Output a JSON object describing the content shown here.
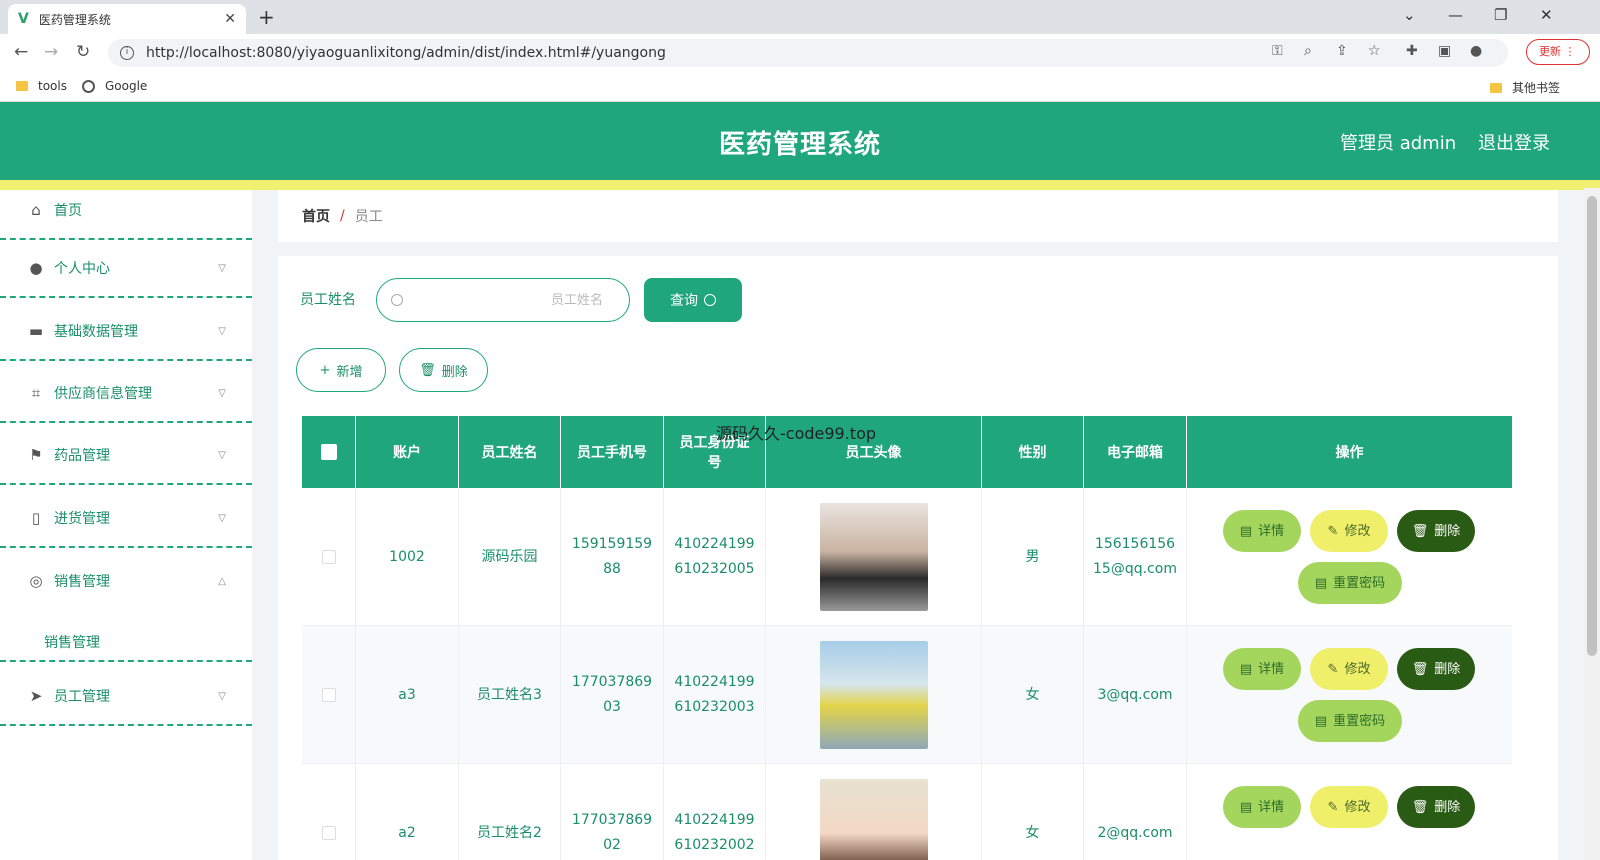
{
  "browser": {
    "tab_title": "医药管理系统",
    "url": "http://localhost:8080/yiyaoguanlixitong/admin/dist/index.html#/yuangong",
    "update_label": "更新",
    "bookmarks": [
      "tools",
      "Google"
    ],
    "other_bookmarks": "其他书签"
  },
  "header": {
    "title": "医药管理系统",
    "user": "管理员 admin",
    "logout": "退出登录"
  },
  "sidebar": {
    "items": [
      {
        "label": "首页",
        "icon": "home-icon"
      },
      {
        "label": "个人中心",
        "icon": "user-icon"
      },
      {
        "label": "基础数据管理",
        "icon": "monitor-icon"
      },
      {
        "label": "供应商信息管理",
        "icon": "crop-icon"
      },
      {
        "label": "药品管理",
        "icon": "flag-icon"
      },
      {
        "label": "进货管理",
        "icon": "phone-icon"
      },
      {
        "label": "销售管理",
        "icon": "disc-icon"
      },
      {
        "label": "员工管理",
        "icon": "send-icon"
      }
    ],
    "submenu": "销售管理"
  },
  "breadcrumb": {
    "home": "首页",
    "sep": "/",
    "current": "员工"
  },
  "search": {
    "label": "员工姓名",
    "placeholder": "员工姓名",
    "query_label": "查询"
  },
  "actions": {
    "add": "新增",
    "delete": "删除"
  },
  "table": {
    "columns": [
      "账户",
      "员工姓名",
      "员工手机号",
      "员工身份证号",
      "员工头像",
      "性别",
      "电子邮箱",
      "操作"
    ],
    "rows": [
      {
        "account": "1002",
        "name": "源码乐园",
        "phone": "15915915988",
        "idcard": "410224199610232005",
        "gender": "男",
        "email": "15615615615@qq.com"
      },
      {
        "account": "a3",
        "name": "员工姓名3",
        "phone": "17703786903",
        "idcard": "410224199610232003",
        "gender": "女",
        "email": "3@qq.com"
      },
      {
        "account": "a2",
        "name": "员工姓名2",
        "phone": "17703786902",
        "idcard": "410224199610232002",
        "gender": "女",
        "email": "2@qq.com"
      }
    ],
    "ops": {
      "detail": "详情",
      "edit": "修改",
      "delete": "删除",
      "reset": "重置密码"
    }
  },
  "overlay": "源码久久-code99.top",
  "colors": {
    "primary": "#1fa67a",
    "accent_yellow": "#f1f070",
    "delete_dark": "#2a5b14"
  }
}
